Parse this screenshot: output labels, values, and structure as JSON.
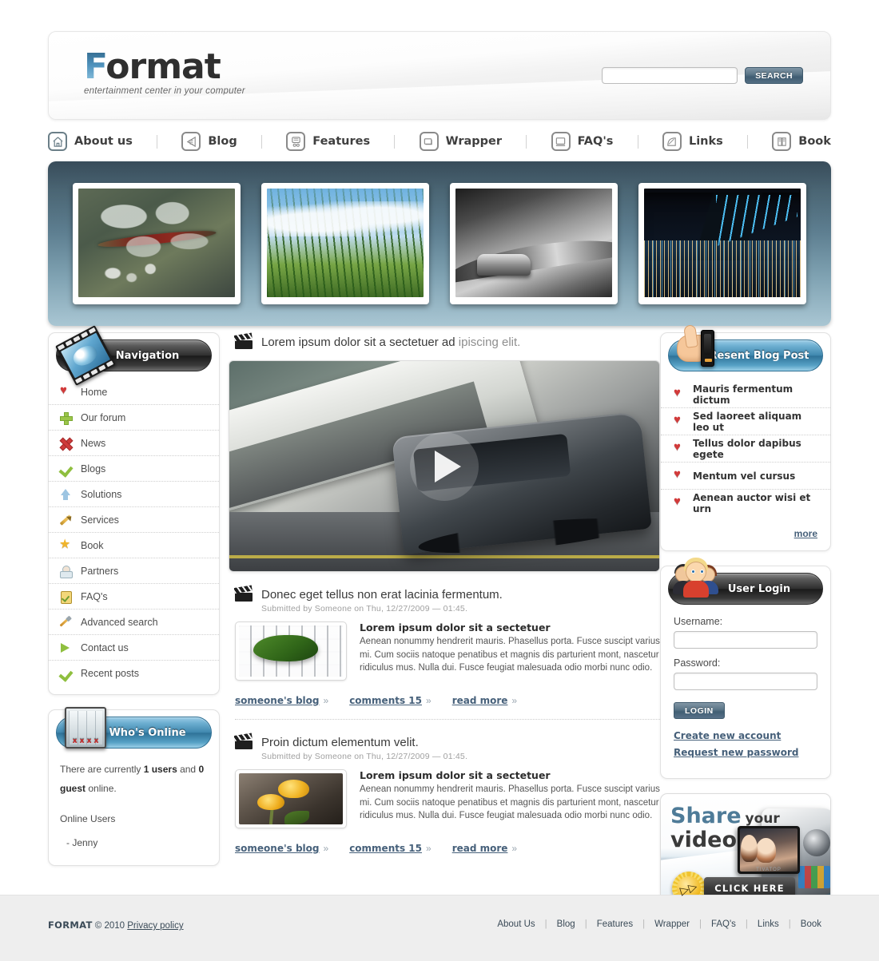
{
  "header": {
    "logo_main": "F",
    "logo_rest": "ormat",
    "tagline": "entertainment center in your computer",
    "search_value": "",
    "search_placeholder": "",
    "search_button": "SEARCH"
  },
  "mainnav": [
    {
      "label": "About us",
      "icon": "home-icon"
    },
    {
      "label": "Blog",
      "icon": "blog-icon"
    },
    {
      "label": "Features",
      "icon": "features-icon"
    },
    {
      "label": "Wrapper",
      "icon": "wrapper-icon"
    },
    {
      "label": "FAQ's",
      "icon": "monitor-icon"
    },
    {
      "label": "Links",
      "icon": "links-icon"
    },
    {
      "label": "Book",
      "icon": "book-icon"
    }
  ],
  "banner": {
    "slides": [
      {
        "name": "dragonflies-photo"
      },
      {
        "name": "grass-sky-photo"
      },
      {
        "name": "sports-car-photo"
      },
      {
        "name": "night-city-bridge-photo"
      }
    ]
  },
  "navigation_panel": {
    "title": "Navigation",
    "items": [
      {
        "label": "Home",
        "icon": "heart-icon"
      },
      {
        "label": "Our forum",
        "icon": "plus-icon"
      },
      {
        "label": "News",
        "icon": "x-cross-icon"
      },
      {
        "label": "Blogs",
        "icon": "check-icon"
      },
      {
        "label": "Solutions",
        "icon": "up-arrow-icon"
      },
      {
        "label": "Services",
        "icon": "pencil-icon"
      },
      {
        "label": "Book",
        "icon": "star-icon"
      },
      {
        "label": "Partners",
        "icon": "user-card-icon"
      },
      {
        "label": "FAQ's",
        "icon": "clipboard-icon"
      },
      {
        "label": "Advanced search",
        "icon": "screwdriver-icon"
      },
      {
        "label": "Contact us",
        "icon": "play-icon"
      },
      {
        "label": "Recent posts",
        "icon": "check-icon"
      }
    ]
  },
  "whos_online": {
    "title": "Who's Online",
    "line_pre": "There are currently ",
    "users_count": "1 users",
    "line_mid": " and ",
    "guests_count": "0 guest",
    "line_post": " online.",
    "users_heading": "Online Users",
    "users": [
      "-  Jenny"
    ]
  },
  "main": {
    "heading_dark": "Lorem ipsum dolor sit a sectetuer ad",
    "heading_muted": "ipiscing elit.",
    "video": {
      "name": "featured-video",
      "play_label": "play"
    },
    "articles": [
      {
        "title": "Donec eget tellus non erat lacinia fermentum.",
        "submitted": "Submitted by Someone on Thu, 12/27/2009 — 01:45.",
        "thumb": "lizard-keyboard-photo",
        "lead": "Lorem ipsum dolor sit a sectetuer",
        "body": "Aenean nonummy hendrerit mauris. Phasellus porta. Fusce suscipt varius mi. Cum sociis natoque penatibus et magnis dis parturient mont, nascetur ridiculus mus. Nulla dui. Fusce feugiat malesuada odio morbi nunc odio.",
        "links": [
          "someone's blog",
          "comments 15",
          "read more"
        ]
      },
      {
        "title": "Proin dictum elementum velit.",
        "submitted": "Submitted by Someone on Thu, 12/27/2009 — 01:45.",
        "thumb": "yellow-tulips-photo",
        "lead": "Lorem ipsum dolor sit a sectetuer",
        "body": "Aenean nonummy hendrerit mauris. Phasellus porta. Fusce suscipt varius mi. Cum sociis natoque penatibus et magnis dis parturient mont, nascetur ridiculus mus. Nulla dui. Fusce feugiat malesuada odio morbi nunc odio.",
        "links": [
          "someone's blog",
          "comments 15",
          "read more"
        ]
      }
    ],
    "link_chevron": "»"
  },
  "recent_blog": {
    "title": "Resent Blog Post",
    "items": [
      "Mauris fermentum dictum",
      "Sed laoreet aliquam leo ut",
      "Tellus dolor dapibus egete",
      "Mentum vel cursus",
      "Aenean auctor wisi et urn"
    ],
    "more_label": "more"
  },
  "user_login": {
    "title": "User Login",
    "username_label": "Username:",
    "username_value": "",
    "password_label": "Password:",
    "password_value": "",
    "login_button": "LOGIN",
    "links": [
      "Create new account",
      "Request new password"
    ]
  },
  "promo": {
    "line1_a": "Share",
    "line1_b": "your",
    "line2": "video",
    "button": "CLICK HERE",
    "camera_brand": "TIVATOP"
  },
  "footer": {
    "brand": "FORMAT",
    "copyright": "© 2010",
    "privacy": "Privacy policy",
    "links": [
      "About Us",
      "Blog",
      "Features",
      "Wrapper",
      "FAQ's",
      "Links",
      "Book"
    ],
    "separator": "|"
  },
  "colors": {
    "accent_blue": "#46607a",
    "banner_dark": "#2c4150",
    "banner_light": "#a9c6d3",
    "footer_bg": "#eeeeee",
    "heart_red": "#d23a3a"
  }
}
